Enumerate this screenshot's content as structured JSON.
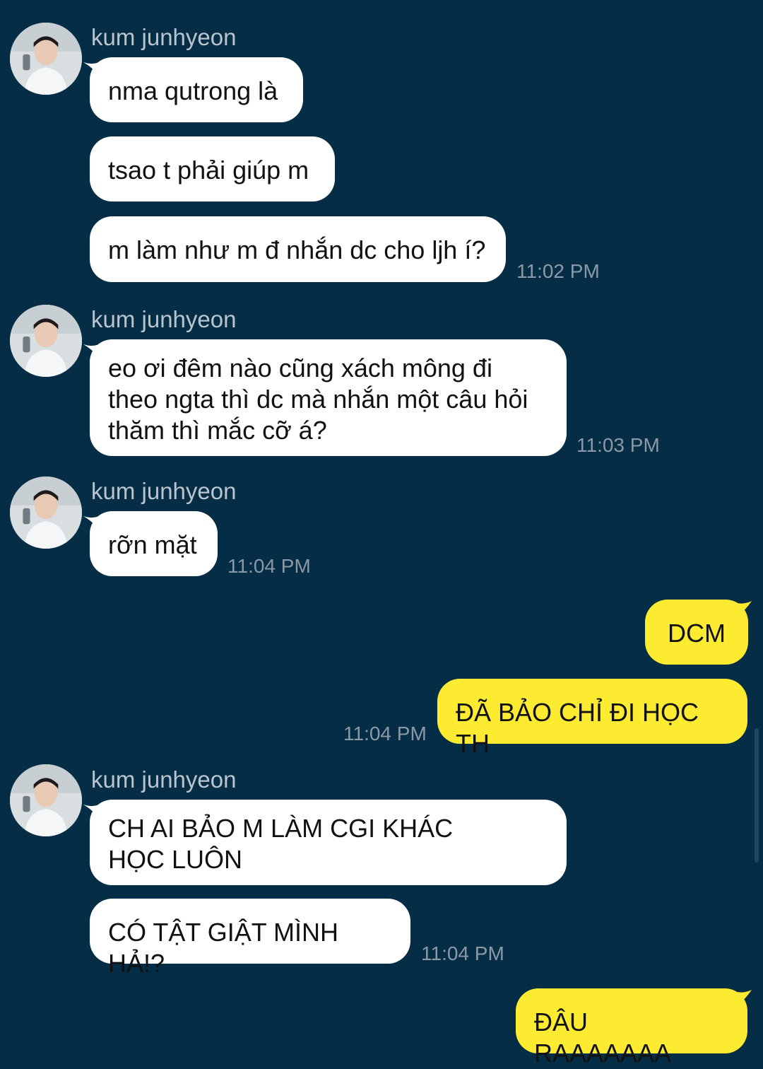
{
  "colors": {
    "background": "#052d45",
    "incoming_bubble": "#ffffff",
    "outgoing_bubble": "#fdeb32",
    "timestamp": "#8b99a4",
    "sender": "#b9c4cc"
  },
  "groups": [
    {
      "sender": "kum junhyeon",
      "messages": [
        "nma qutrong là",
        "tsao t phải giúp m",
        "m làm như m đ nhắn dc cho ljh í?"
      ],
      "time": "11:02 PM"
    },
    {
      "sender": "kum junhyeon",
      "messages": [
        "eo ơi đêm nào cũng xách mông đi theo ngta thì dc mà nhắn một câu hỏi thăm thì mắc cỡ á?"
      ],
      "time": "11:03 PM"
    },
    {
      "sender": "kum junhyeon",
      "messages": [
        "rỡn mặt"
      ],
      "time": "11:04 PM"
    },
    {
      "outgoing": true,
      "messages": [
        "DCM",
        "ĐÃ BẢO CHỈ ĐI HỌC TH"
      ],
      "time": "11:04 PM"
    },
    {
      "sender": "kum junhyeon",
      "messages": [
        "CH AI BẢO M LÀM CGI KHÁC HỌC LUÔN",
        "CÓ TẬT GIẬT MÌNH HẢ!?"
      ],
      "time": "11:04 PM"
    },
    {
      "outgoing": true,
      "messages": [
        "ĐÂU RAAAAAAA"
      ]
    }
  ]
}
